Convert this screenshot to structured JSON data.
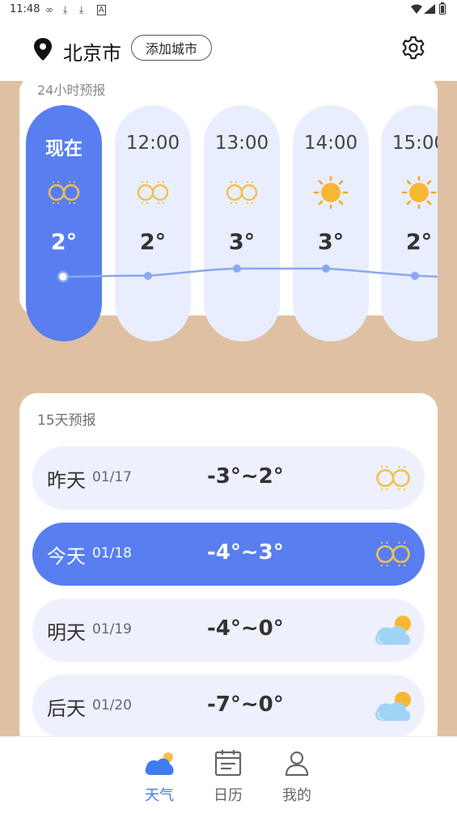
{
  "status_bar": {
    "time": "11:48",
    "icons": [
      "infinity-icon",
      "download-icon",
      "download-icon",
      "a-box-icon"
    ],
    "right_icons": [
      "wifi-icon",
      "signal-icon",
      "battery-icon"
    ]
  },
  "header": {
    "city": "北京市",
    "add_city_label": "添加城市",
    "location_icon": "location-pin-icon",
    "settings_icon": "gear-icon"
  },
  "hourly": {
    "title": "24小时预报",
    "items": [
      {
        "time": "现在",
        "temp": "2°",
        "icon": "haze-icon",
        "active": true
      },
      {
        "time": "12:00",
        "temp": "2°",
        "icon": "haze-icon",
        "active": false
      },
      {
        "time": "13:00",
        "temp": "3°",
        "icon": "haze-icon",
        "active": false
      },
      {
        "time": "14:00",
        "temp": "3°",
        "icon": "sun-icon",
        "active": false
      },
      {
        "time": "15:00",
        "temp": "2°",
        "icon": "sun-icon",
        "active": false
      }
    ]
  },
  "daily": {
    "title": "15天预报",
    "items": [
      {
        "day": "昨天",
        "date": "01/17",
        "temp": "-3°~2°",
        "icon": "haze-icon",
        "active": false
      },
      {
        "day": "今天",
        "date": "01/18",
        "temp": "-4°~3°",
        "icon": "haze-icon",
        "active": true
      },
      {
        "day": "明天",
        "date": "01/19",
        "temp": "-4°~0°",
        "icon": "cloudy-sun-icon",
        "active": false
      },
      {
        "day": "后天",
        "date": "01/20",
        "temp": "-7°~0°",
        "icon": "cloudy-sun-icon",
        "active": false
      }
    ]
  },
  "bottom_nav": {
    "items": [
      {
        "label": "天气",
        "icon": "weather-cloud-icon",
        "active": true
      },
      {
        "label": "日历",
        "icon": "calendar-icon",
        "active": false
      },
      {
        "label": "我的",
        "icon": "person-icon",
        "active": false
      }
    ]
  },
  "colors": {
    "accent": "#587ef0",
    "background": "#dfc0a2",
    "card": "#ffffff",
    "row": "#eef0fe",
    "nav_active": "#3e7df0"
  }
}
